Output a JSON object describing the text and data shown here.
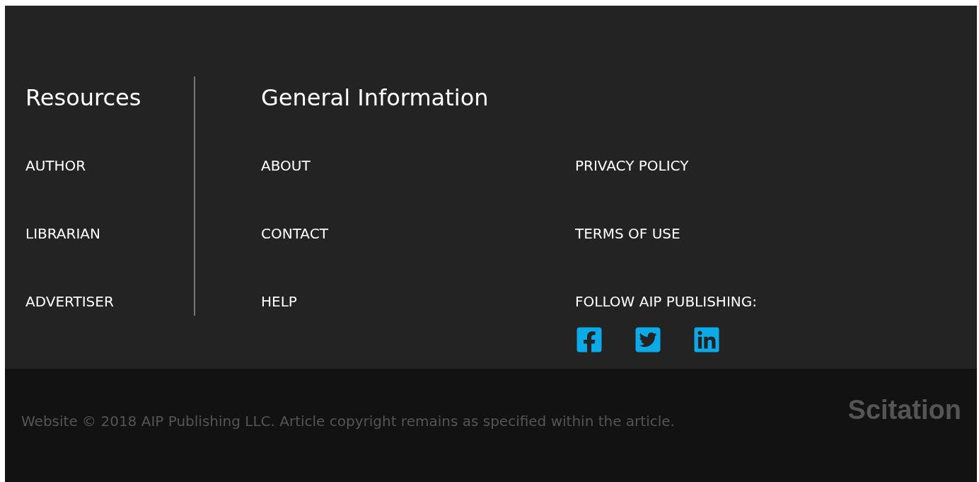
{
  "resources": {
    "heading": "Resources",
    "links": [
      "AUTHOR",
      "LIBRARIAN",
      "ADVERTISER"
    ]
  },
  "general_information": {
    "heading": "General Information",
    "links_column_1": [
      "ABOUT",
      "CONTACT",
      "HELP"
    ],
    "links_column_2": [
      "PRIVACY POLICY",
      "TERMS OF USE",
      "FOLLOW AIP PUBLISHING:"
    ]
  },
  "copyright": "Website © 2018 AIP Publishing LLC. Article copyright remains as specified within the article.",
  "logo": "Scitation"
}
